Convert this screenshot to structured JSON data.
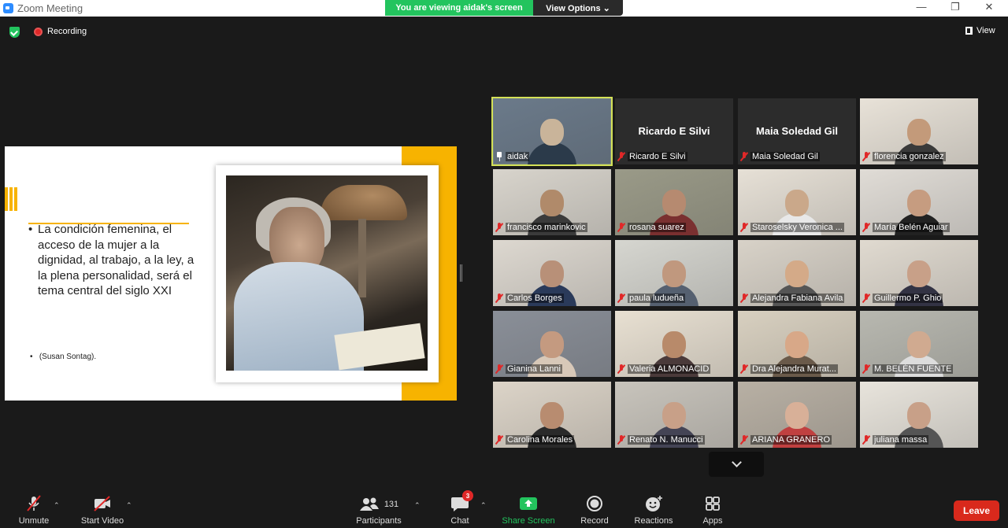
{
  "window": {
    "title": "Zoom Meeting",
    "minimize": "—",
    "restore": "❐",
    "close": "✕"
  },
  "banner": {
    "viewing": "You are viewing aidak's screen",
    "view_options": "View Options ⌄"
  },
  "status": {
    "recording": "Recording",
    "view": "View"
  },
  "slide": {
    "quote": "La condición femenina, el acceso de la mujer a la dignidad, al trabajo, a la ley, a la plena personalidad, será el tema central del siglo XXI",
    "citation": "(Susan Sontag)."
  },
  "participants": [
    {
      "name": "aidak",
      "pinned": true,
      "active": true
    },
    {
      "name": "Ricardo E Silvi",
      "video_off": true
    },
    {
      "name": "Maia  Soledad Gil",
      "video_off": true
    },
    {
      "name": "florencia gonzalez"
    },
    {
      "name": "francisco marinkovic"
    },
    {
      "name": "rosana suarez"
    },
    {
      "name": "Staroselsky Veronica ..."
    },
    {
      "name": "María Belén Aguiar"
    },
    {
      "name": "Carlos Borges"
    },
    {
      "name": "paula ludueña"
    },
    {
      "name": "Alejandra Fabiana Avila"
    },
    {
      "name": "Guillermo P. Ghio"
    },
    {
      "name": "Gianina Lanni"
    },
    {
      "name": "Valeria ALMONACID"
    },
    {
      "name": "Dra Alejandra Murat..."
    },
    {
      "name": "M. BELÉN FUENTE"
    },
    {
      "name": "Carolina Morales"
    },
    {
      "name": "Renato N. Manucci"
    },
    {
      "name": "ARIANA GRANERO"
    },
    {
      "name": "juliana massa"
    }
  ],
  "toolbar": {
    "unmute": "Unmute",
    "start_video": "Start Video",
    "participants": "Participants",
    "participants_count": "131",
    "chat": "Chat",
    "chat_badge": "3",
    "share_screen": "Share Screen",
    "record": "Record",
    "reactions": "Reactions",
    "apps": "Apps",
    "leave": "Leave",
    "caret": "⌃"
  },
  "colors": {
    "accent_green": "#23c45e",
    "leave_red": "#d9291c",
    "active_speaker": "#d4e157",
    "slide_yellow": "#f7b300"
  }
}
